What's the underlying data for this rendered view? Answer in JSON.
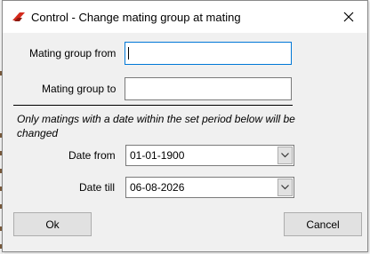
{
  "window": {
    "title": "Control - Change mating group at mating",
    "icon": "app-logo-icon",
    "close_icon": "close-icon"
  },
  "form": {
    "mating_group_from_label": "Mating group from",
    "mating_group_from_value": "",
    "mating_group_to_label": "Mating group to",
    "mating_group_to_value": "",
    "note": "Only matings with a date within the set period below will be changed",
    "date_from_label": "Date from",
    "date_from_value": "01-01-1900",
    "date_till_label": "Date till",
    "date_till_value": "06-08-2026"
  },
  "buttons": {
    "ok": "Ok",
    "cancel": "Cancel"
  },
  "colors": {
    "accent_icon": "#d42a1c",
    "focus_border": "#0078d7"
  }
}
